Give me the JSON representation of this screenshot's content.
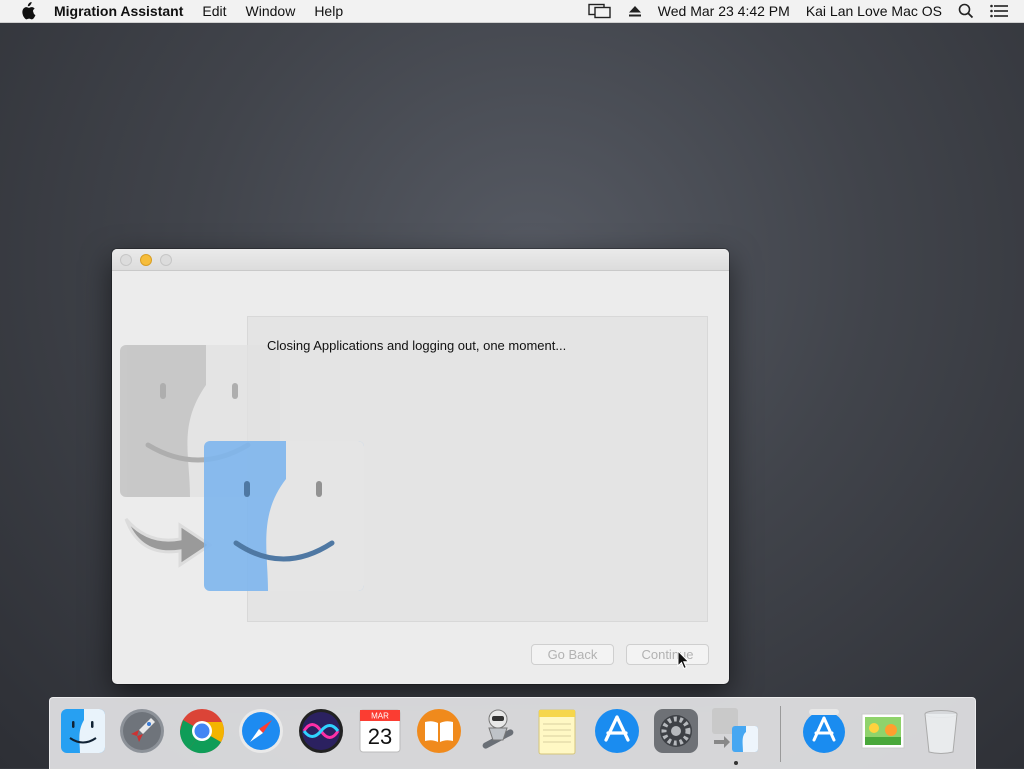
{
  "menubar": {
    "app_name": "Migration Assistant",
    "menus": [
      "Edit",
      "Window",
      "Help"
    ],
    "clock": "Wed Mar 23  4:42 PM",
    "user": "Kai Lan Love Mac OS"
  },
  "window": {
    "status_message": "Closing Applications and logging out, one moment...",
    "buttons": {
      "go_back": "Go Back",
      "continue": "Continue"
    }
  },
  "calendar": {
    "month": "MAR",
    "day": "23"
  },
  "dock": {
    "items": [
      "finder-icon",
      "launchpad-icon",
      "chrome-icon",
      "safari-icon",
      "siri-icon",
      "calendar-icon",
      "books-icon",
      "automator-icon",
      "notes-icon",
      "app-store-icon",
      "system-preferences-icon",
      "migration-assistant-icon",
      "app-store-downloads-icon",
      "photo-icon",
      "trash-icon"
    ],
    "running": [
      "migration-assistant-icon"
    ]
  },
  "colors": {
    "accent_blue": "#1d8bf1",
    "minimize_yellow": "#f6bd3b",
    "desktop": "#41444b"
  }
}
